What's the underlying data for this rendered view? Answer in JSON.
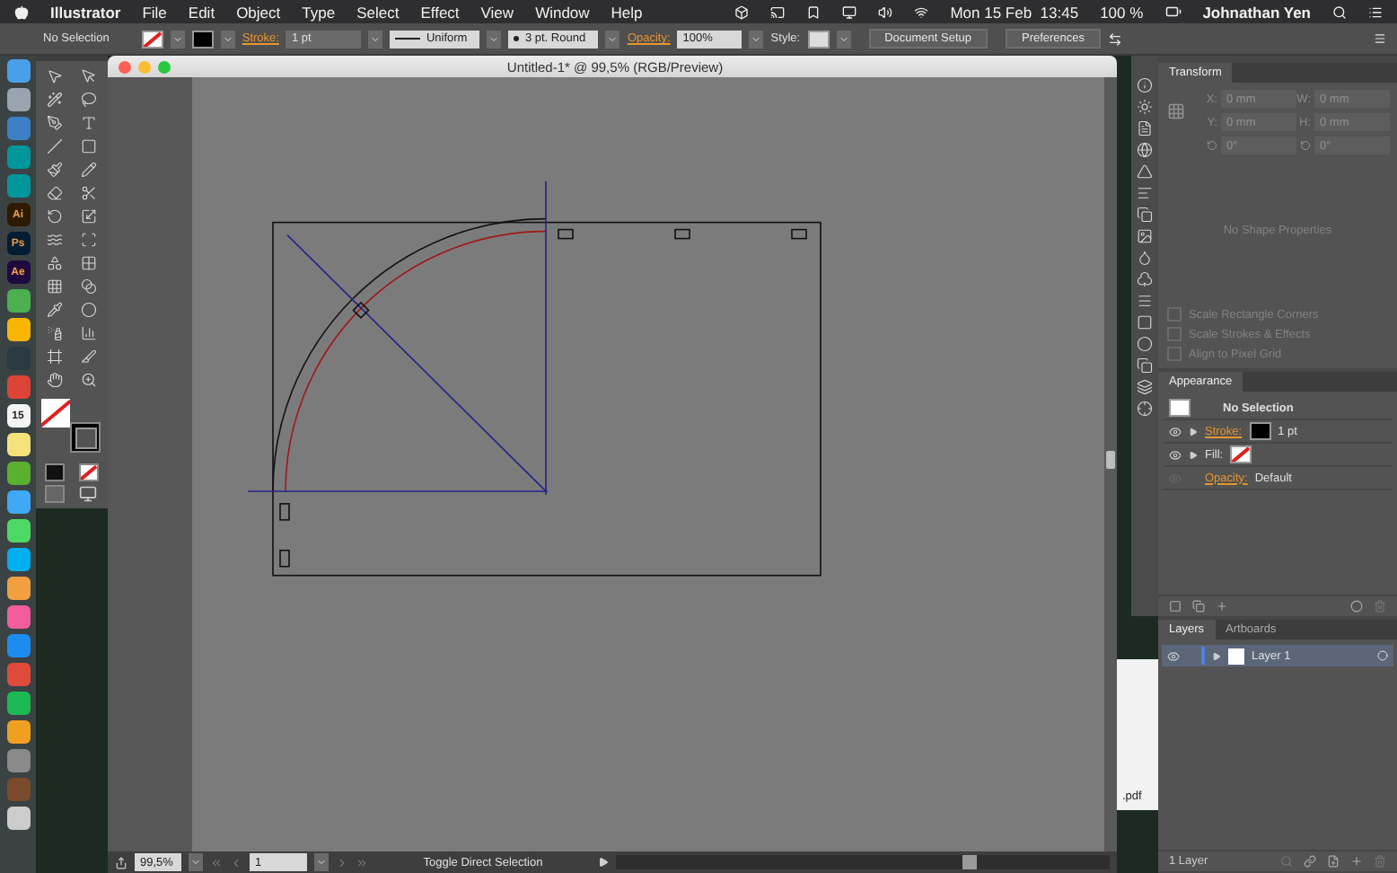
{
  "menubar": {
    "app": "Illustrator",
    "menus": [
      "File",
      "Edit",
      "Object",
      "Type",
      "Select",
      "Effect",
      "View",
      "Window",
      "Help"
    ],
    "clock": "Mon 15 Feb  13:45",
    "battery": "100 %",
    "user": "Johnathan Yen"
  },
  "control_bar": {
    "selection": "No Selection",
    "stroke_label": "Stroke:",
    "stroke_weight": "1 pt",
    "profile": "Uniform",
    "brush": "3 pt. Round",
    "opacity_label": "Opacity:",
    "opacity": "100%",
    "style_label": "Style:",
    "buttons": [
      "Document Setup",
      "Preferences"
    ]
  },
  "dock": [
    {
      "color": "#4aa0e8"
    },
    {
      "color": "#9aa4b0"
    },
    {
      "color": "#3b7fc4"
    },
    {
      "color": "#00979c"
    },
    {
      "color": "#00979c"
    },
    {
      "color": "#2d1a00",
      "label": "Ai"
    },
    {
      "color": "#001d34",
      "label": "Ps"
    },
    {
      "color": "#1f0a40",
      "label": "Ae"
    },
    {
      "color": "#4caf50"
    },
    {
      "color": "#f7b500"
    },
    {
      "color": "#2a3a40"
    },
    {
      "color": "#db4437"
    },
    {
      "color": "#f4f4f4",
      "label": "15"
    },
    {
      "color": "#f5e27a"
    },
    {
      "color": "#5cb030"
    },
    {
      "color": "#3fa9f5"
    },
    {
      "color": "#4cd964"
    },
    {
      "color": "#00aff0"
    },
    {
      "color": "#f0a040"
    },
    {
      "color": "#f25c9a"
    },
    {
      "color": "#1d8cf0"
    },
    {
      "color": "#e04a3a"
    },
    {
      "color": "#1db954"
    },
    {
      "color": "#f0a020"
    },
    {
      "color": "#8a8a8a"
    },
    {
      "color": "#7a4a2a"
    },
    {
      "color": "#cccccc"
    }
  ],
  "document": {
    "title": "Untitled-1* @ 99,5% (RGB/Preview)"
  },
  "status_bar": {
    "zoom": "99,5%",
    "artboard": "1",
    "tool": "Toggle Direct Selection"
  },
  "desktop": {
    "file_label": ".pdf"
  },
  "transform": {
    "title": "Transform",
    "disabled": true,
    "fields": [
      {
        "label": "X:",
        "value": "0 mm"
      },
      {
        "label": "W:",
        "value": "0 mm"
      },
      {
        "label": "Y:",
        "value": "0 mm"
      },
      {
        "label": "H:",
        "value": "0 mm"
      }
    ],
    "angles": [
      "0°",
      "0°"
    ],
    "message": "No Shape Properties",
    "options": [
      {
        "label": "Scale Rectangle Corners",
        "checked": false
      },
      {
        "label": "Scale Strokes & Effects",
        "checked": false
      },
      {
        "label": "Align to Pixel Grid",
        "checked": false
      }
    ]
  },
  "appearance": {
    "title": "Appearance",
    "heading": "No Selection",
    "rows": [
      {
        "kind": "stroke",
        "label": "Stroke:",
        "value": "1 pt"
      },
      {
        "kind": "fill",
        "label": "Fill:"
      },
      {
        "kind": "opacity",
        "label": "Opacity:",
        "value": "Default"
      }
    ]
  },
  "layers": {
    "tabs": [
      {
        "label": "Layers",
        "selected": true
      },
      {
        "label": "Artboards",
        "selected": false
      }
    ],
    "items": [
      {
        "name": "Layer 1",
        "selected": true
      }
    ],
    "count": "1 Layer"
  }
}
